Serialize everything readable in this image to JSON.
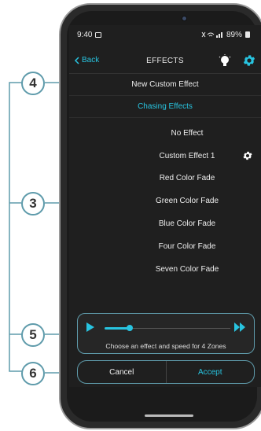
{
  "callouts": [
    "4",
    "3",
    "5",
    "6"
  ],
  "status_bar": {
    "time": "9:40",
    "battery": "89%"
  },
  "topbar": {
    "back_label": "Back",
    "title": "EFFECTS"
  },
  "menu": {
    "new_custom_effect": "New Custom Effect",
    "chasing_effects": "Chasing Effects"
  },
  "effects": [
    "No Effect",
    "Custom Effect 1",
    "Red Color Fade",
    "Green Color Fade",
    "Blue Color Fade",
    "Four Color Fade",
    "Seven Color Fade"
  ],
  "player": {
    "caption": "Choose an effect and speed for 4 Zones",
    "speed_fraction": 0.2
  },
  "footer": {
    "cancel_label": "Cancel",
    "accept_label": "Accept"
  },
  "colors": {
    "accent": "#28c4e0",
    "callout": "#5f9bab",
    "screen_bg": "#1f1f1f"
  }
}
